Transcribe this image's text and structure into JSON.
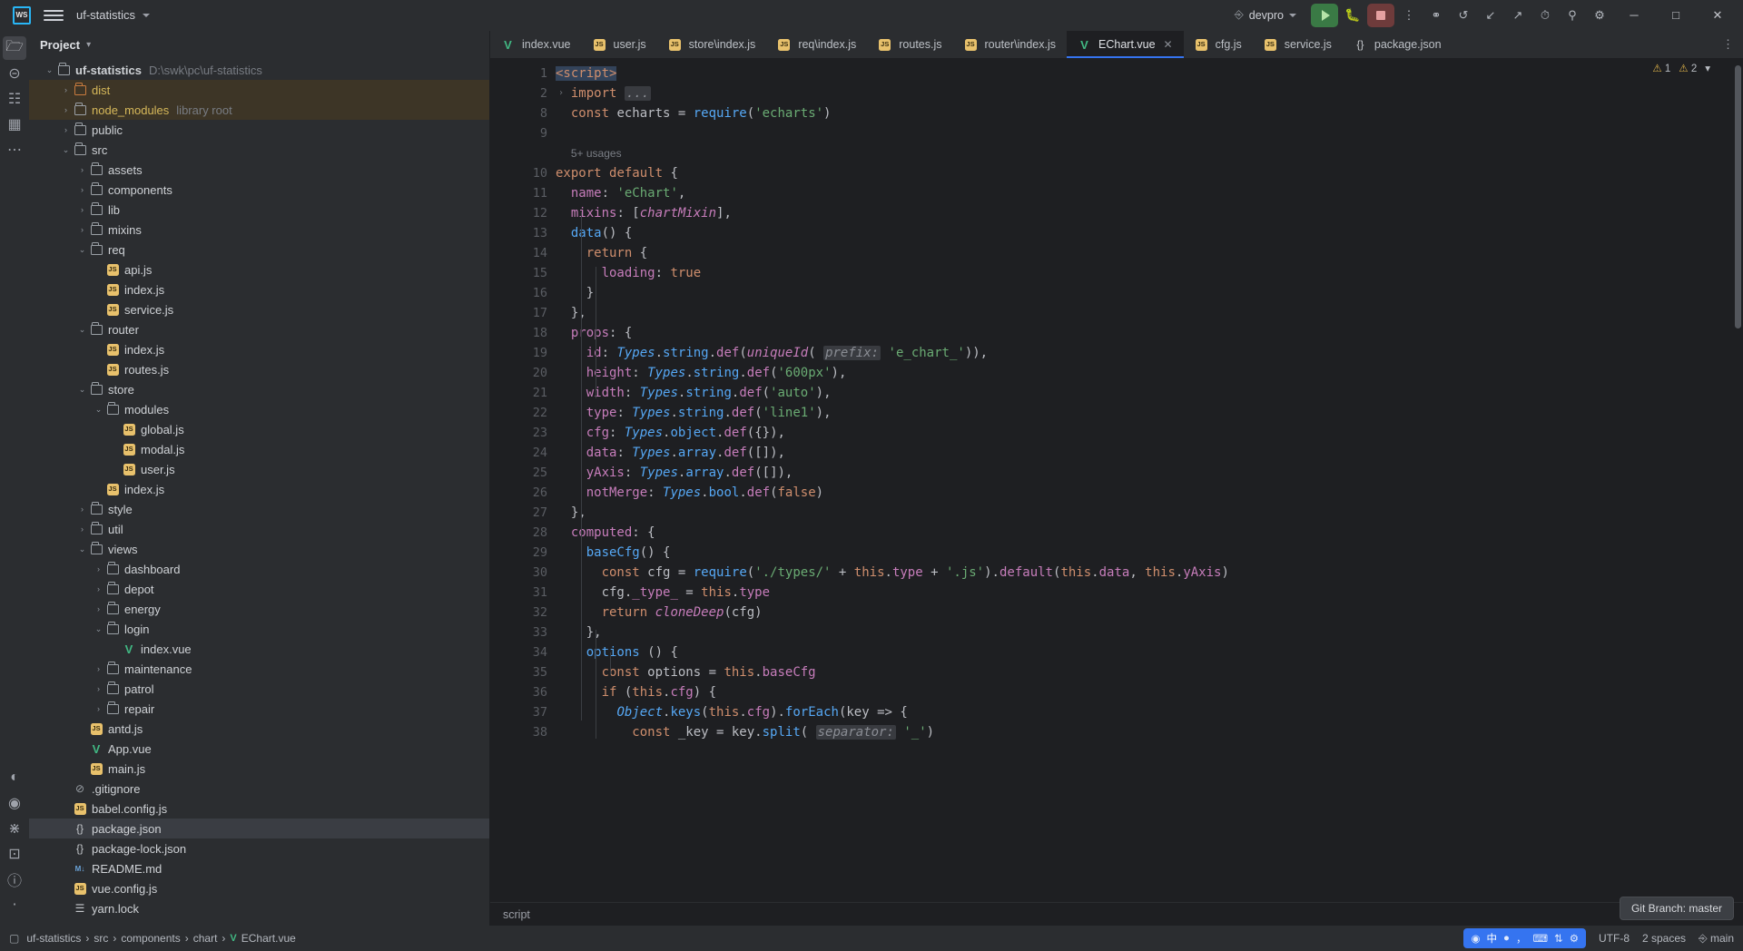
{
  "titlebar": {
    "logo": "WS",
    "project_name": "uf-statistics",
    "branch": "devpro",
    "icons": [
      "hamburger-menu",
      "run-config",
      "debug",
      "stop",
      "more-options",
      "settings-sync",
      "undo",
      "navigate-down",
      "navigate-up",
      "clock-history",
      "search-everywhere",
      "settings"
    ],
    "window_controls": [
      "minimize",
      "maximize",
      "close"
    ]
  },
  "toolstrip": {
    "items": [
      {
        "name": "project",
        "glyph": "☐",
        "active": true
      },
      {
        "name": "commit",
        "glyph": "⊖",
        "active": false
      },
      {
        "name": "structure",
        "glyph": "⛓",
        "active": false
      },
      {
        "name": "bookmarks",
        "glyph": "▣",
        "active": false
      },
      {
        "name": "more-tool-windows",
        "glyph": "⋯",
        "active": false
      }
    ],
    "bottom_items": [
      {
        "name": "problems",
        "glyph": "◔"
      },
      {
        "name": "services",
        "glyph": "⚙"
      },
      {
        "name": "version-control",
        "glyph": "⎇"
      },
      {
        "name": "terminal",
        "glyph": "⌨"
      },
      {
        "name": "notifications",
        "glyph": "ⓘ"
      },
      {
        "name": "git",
        "glyph": "⑂"
      }
    ]
  },
  "project_panel": {
    "title": "Project",
    "tree": [
      {
        "depth": 0,
        "arrow": "down",
        "icon": "folder",
        "name": "uf-statistics",
        "meta": "D:\\swk\\pc\\uf-statistics",
        "bold": true,
        "state": "normal"
      },
      {
        "depth": 1,
        "arrow": "right",
        "icon": "folder-orange",
        "name": "dist",
        "meta": "",
        "color": "yellow",
        "state": "hl"
      },
      {
        "depth": 1,
        "arrow": "right",
        "icon": "folder",
        "name": "node_modules",
        "meta": "library root",
        "color": "yellow",
        "state": "hl"
      },
      {
        "depth": 1,
        "arrow": "right",
        "icon": "folder",
        "name": "public",
        "meta": "",
        "state": "normal"
      },
      {
        "depth": 1,
        "arrow": "down",
        "icon": "folder",
        "name": "src",
        "meta": "",
        "state": "normal"
      },
      {
        "depth": 2,
        "arrow": "right",
        "icon": "folder",
        "name": "assets",
        "meta": "",
        "state": "normal"
      },
      {
        "depth": 2,
        "arrow": "right",
        "icon": "folder",
        "name": "components",
        "meta": "",
        "state": "normal"
      },
      {
        "depth": 2,
        "arrow": "right",
        "icon": "folder",
        "name": "lib",
        "meta": "",
        "state": "normal"
      },
      {
        "depth": 2,
        "arrow": "right",
        "icon": "folder",
        "name": "mixins",
        "meta": "",
        "state": "normal"
      },
      {
        "depth": 2,
        "arrow": "down",
        "icon": "folder",
        "name": "req",
        "meta": "",
        "state": "normal"
      },
      {
        "depth": 3,
        "arrow": "none",
        "icon": "js",
        "name": "api.js",
        "meta": "",
        "state": "normal"
      },
      {
        "depth": 3,
        "arrow": "none",
        "icon": "js",
        "name": "index.js",
        "meta": "",
        "state": "normal"
      },
      {
        "depth": 3,
        "arrow": "none",
        "icon": "js",
        "name": "service.js",
        "meta": "",
        "state": "normal"
      },
      {
        "depth": 2,
        "arrow": "down",
        "icon": "folder",
        "name": "router",
        "meta": "",
        "state": "normal"
      },
      {
        "depth": 3,
        "arrow": "none",
        "icon": "js",
        "name": "index.js",
        "meta": "",
        "state": "normal"
      },
      {
        "depth": 3,
        "arrow": "none",
        "icon": "js",
        "name": "routes.js",
        "meta": "",
        "state": "normal"
      },
      {
        "depth": 2,
        "arrow": "down",
        "icon": "folder",
        "name": "store",
        "meta": "",
        "state": "normal"
      },
      {
        "depth": 3,
        "arrow": "down",
        "icon": "folder",
        "name": "modules",
        "meta": "",
        "state": "normal"
      },
      {
        "depth": 4,
        "arrow": "none",
        "icon": "js",
        "name": "global.js",
        "meta": "",
        "state": "normal"
      },
      {
        "depth": 4,
        "arrow": "none",
        "icon": "js",
        "name": "modal.js",
        "meta": "",
        "state": "normal"
      },
      {
        "depth": 4,
        "arrow": "none",
        "icon": "js",
        "name": "user.js",
        "meta": "",
        "state": "normal"
      },
      {
        "depth": 3,
        "arrow": "none",
        "icon": "js",
        "name": "index.js",
        "meta": "",
        "state": "normal"
      },
      {
        "depth": 2,
        "arrow": "right",
        "icon": "folder",
        "name": "style",
        "meta": "",
        "state": "normal"
      },
      {
        "depth": 2,
        "arrow": "right",
        "icon": "folder",
        "name": "util",
        "meta": "",
        "state": "normal"
      },
      {
        "depth": 2,
        "arrow": "down",
        "icon": "folder",
        "name": "views",
        "meta": "",
        "state": "normal"
      },
      {
        "depth": 3,
        "arrow": "right",
        "icon": "folder",
        "name": "dashboard",
        "meta": "",
        "state": "normal"
      },
      {
        "depth": 3,
        "arrow": "right",
        "icon": "folder",
        "name": "depot",
        "meta": "",
        "state": "normal"
      },
      {
        "depth": 3,
        "arrow": "right",
        "icon": "folder",
        "name": "energy",
        "meta": "",
        "state": "normal"
      },
      {
        "depth": 3,
        "arrow": "down",
        "icon": "folder",
        "name": "login",
        "meta": "",
        "state": "normal"
      },
      {
        "depth": 4,
        "arrow": "none",
        "icon": "vue",
        "name": "index.vue",
        "meta": "",
        "state": "normal"
      },
      {
        "depth": 3,
        "arrow": "right",
        "icon": "folder",
        "name": "maintenance",
        "meta": "",
        "state": "normal"
      },
      {
        "depth": 3,
        "arrow": "right",
        "icon": "folder",
        "name": "patrol",
        "meta": "",
        "state": "normal"
      },
      {
        "depth": 3,
        "arrow": "right",
        "icon": "folder",
        "name": "repair",
        "meta": "",
        "state": "normal"
      },
      {
        "depth": 2,
        "arrow": "none",
        "icon": "js",
        "name": "antd.js",
        "meta": "",
        "state": "normal"
      },
      {
        "depth": 2,
        "arrow": "none",
        "icon": "vue",
        "name": "App.vue",
        "meta": "",
        "state": "normal"
      },
      {
        "depth": 2,
        "arrow": "none",
        "icon": "js",
        "name": "main.js",
        "meta": "",
        "state": "normal"
      },
      {
        "depth": 1,
        "arrow": "none",
        "icon": "gitignore",
        "name": ".gitignore",
        "meta": "",
        "state": "normal"
      },
      {
        "depth": 1,
        "arrow": "none",
        "icon": "js",
        "name": "babel.config.js",
        "meta": "",
        "state": "normal"
      },
      {
        "depth": 1,
        "arrow": "none",
        "icon": "json",
        "name": "package.json",
        "meta": "",
        "state": "selfile"
      },
      {
        "depth": 1,
        "arrow": "none",
        "icon": "json",
        "name": "package-lock.json",
        "meta": "",
        "state": "normal"
      },
      {
        "depth": 1,
        "arrow": "none",
        "icon": "md",
        "name": "README.md",
        "meta": "",
        "state": "normal"
      },
      {
        "depth": 1,
        "arrow": "none",
        "icon": "js",
        "name": "vue.config.js",
        "meta": "",
        "state": "normal"
      },
      {
        "depth": 1,
        "arrow": "none",
        "icon": "yarn",
        "name": "yarn.lock",
        "meta": "",
        "state": "normal"
      }
    ]
  },
  "editor": {
    "tabs": [
      {
        "label": "index.vue",
        "icon": "vue",
        "active": false,
        "closable": false
      },
      {
        "label": "user.js",
        "icon": "js",
        "active": false,
        "closable": false
      },
      {
        "label": "store\\index.js",
        "icon": "js",
        "active": false,
        "closable": false
      },
      {
        "label": "req\\index.js",
        "icon": "js",
        "active": false,
        "closable": false
      },
      {
        "label": "routes.js",
        "icon": "js",
        "active": false,
        "closable": false
      },
      {
        "label": "router\\index.js",
        "icon": "js",
        "active": false,
        "closable": false
      },
      {
        "label": "EChart.vue",
        "icon": "vue",
        "active": true,
        "closable": true
      },
      {
        "label": "cfg.js",
        "icon": "js",
        "active": false,
        "closable": false
      },
      {
        "label": "service.js",
        "icon": "js",
        "active": false,
        "closable": false
      },
      {
        "label": "package.json",
        "icon": "json",
        "active": false,
        "closable": false
      }
    ],
    "inspection": {
      "warnings": "1",
      "weak_warnings": "2"
    },
    "usage_hint": "5+ usages",
    "line_numbers": [
      "1",
      "2",
      "8",
      "9",
      "",
      "10",
      "11",
      "12",
      "13",
      "14",
      "15",
      "16",
      "17",
      "18",
      "19",
      "20",
      "21",
      "22",
      "23",
      "24",
      "25",
      "26",
      "27",
      "28",
      "29",
      "30",
      "31",
      "32",
      "33",
      "34",
      "35",
      "36",
      "37",
      "38"
    ],
    "code_lines": [
      "<script>",
      "  import ...",
      "  const echarts = require('echarts')",
      "",
      "5+ usages",
      "export default {",
      "  name: 'eChart',",
      "  mixins: [chartMixin],",
      "  data() {",
      "    return {",
      "      loading: true",
      "    }",
      "  },",
      "  props: {",
      "    id: Types.string.def(uniqueId( prefix: 'e_chart_')),",
      "    height: Types.string.def('600px'),",
      "    width: Types.string.def('auto'),",
      "    type: Types.string.def('line1'),",
      "    cfg: Types.object.def({}),",
      "    data: Types.array.def([]),",
      "    yAxis: Types.array.def([]),",
      "    notMerge: Types.bool.def(false)",
      "  },",
      "  computed: {",
      "    baseCfg() {",
      "      const cfg = require('./types/' + this.type + '.js').default(this.data, this.yAxis)",
      "      cfg._type_ = this.type",
      "      return cloneDeep(cfg)",
      "    },",
      "    options () {",
      "      const options = this.baseCfg",
      "      if (this.cfg) {",
      "        Object.keys(this.cfg).forEach(key => {",
      "          const _key = key.split( separator: '_')"
    ],
    "breadcrumb_bottom": "script"
  },
  "statusbar": {
    "crumbs": [
      "uf-statistics",
      "src",
      "components",
      "chart",
      "EChart.vue"
    ],
    "crumb_last_icon": "vue",
    "ime": {
      "camera": "◉",
      "lang": "中",
      "dot": "●",
      "sep": "，",
      "kb": "⌨",
      "arrows": "⇅",
      "gear": "⚙"
    },
    "encoding": "UTF-8",
    "indent": "2 spaces",
    "branch": "main",
    "branch_icon": "git-branch-icon",
    "tooltip": "Git Branch: master"
  }
}
